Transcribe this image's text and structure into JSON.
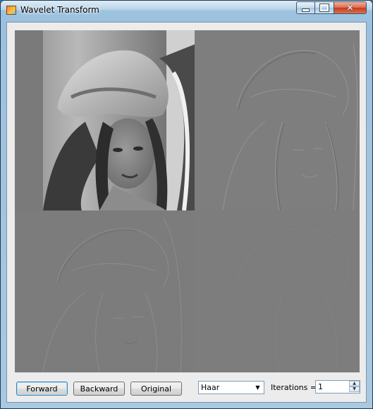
{
  "window": {
    "title": "Wavelet Transform",
    "app_icon": "wavelet-app-icon",
    "controls": {
      "minimize_icon": "minimize-icon",
      "maximize_icon": "maximize-icon",
      "close_icon": "close-icon",
      "close_glyph": "✕"
    }
  },
  "image_panel": {
    "quadrants": [
      {
        "name": "approximation-image",
        "description_icon": "photo"
      },
      {
        "name": "horizontal-detail-image",
        "description_icon": "photo"
      },
      {
        "name": "vertical-detail-image",
        "description_icon": "photo"
      },
      {
        "name": "diagonal-detail-image",
        "description_icon": "photo"
      }
    ]
  },
  "toolbar": {
    "forward_label": "Forward",
    "backward_label": "Backward",
    "original_label": "Original",
    "wavelet_selected": "Haar",
    "dropdown_arrow": "▼",
    "iterations_label": "Iterations =",
    "iterations_value": "1",
    "spin_up": "▲",
    "spin_down": "▼"
  }
}
